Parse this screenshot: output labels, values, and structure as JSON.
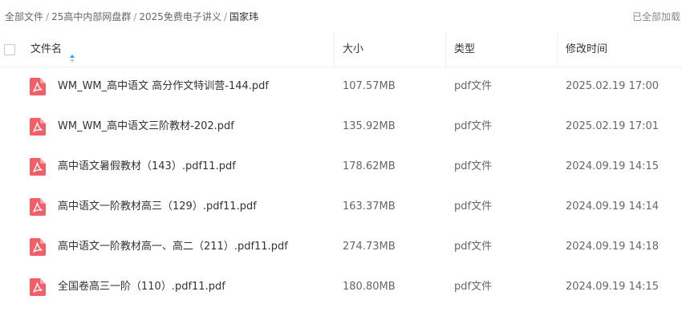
{
  "breadcrumb": {
    "items": [
      "全部文件",
      "25高中内部网盘群",
      "2025免费电子讲义",
      "国家玮"
    ],
    "separator": "/"
  },
  "status": {
    "loaded_text": "已全部加载"
  },
  "table": {
    "columns": {
      "name": "文件名",
      "size": "大小",
      "type": "类型",
      "modified": "修改时间"
    },
    "rows": [
      {
        "name": "WM_WM_高中语文 高分作文特训营-144.pdf",
        "size": "107.57MB",
        "type": "pdf文件",
        "modified": "2025.02.19 17:00"
      },
      {
        "name": "WM_WM_高中语文三阶教材-202.pdf",
        "size": "135.92MB",
        "type": "pdf文件",
        "modified": "2025.02.19 17:01"
      },
      {
        "name": "高中语文暑假教材（143）.pdf11.pdf",
        "size": "178.62MB",
        "type": "pdf文件",
        "modified": "2024.09.19 14:15"
      },
      {
        "name": "高中语文一阶教材高三（129）.pdf11.pdf",
        "size": "163.37MB",
        "type": "pdf文件",
        "modified": "2024.09.19 14:14"
      },
      {
        "name": "高中语文一阶教材高一、高二（211）.pdf11.pdf",
        "size": "274.73MB",
        "type": "pdf文件",
        "modified": "2024.09.19 14:18"
      },
      {
        "name": "全国卷高三一阶（110）.pdf11.pdf",
        "size": "180.80MB",
        "type": "pdf文件",
        "modified": "2024.09.19 14:15"
      }
    ]
  },
  "icons": {
    "file": "pdf-file-icon",
    "sort": "sort-arrow-icon"
  },
  "colors": {
    "pdf_icon": "#f35f68",
    "sort_active": "#06a7ff",
    "sort_inactive": "#c8c8c8"
  }
}
